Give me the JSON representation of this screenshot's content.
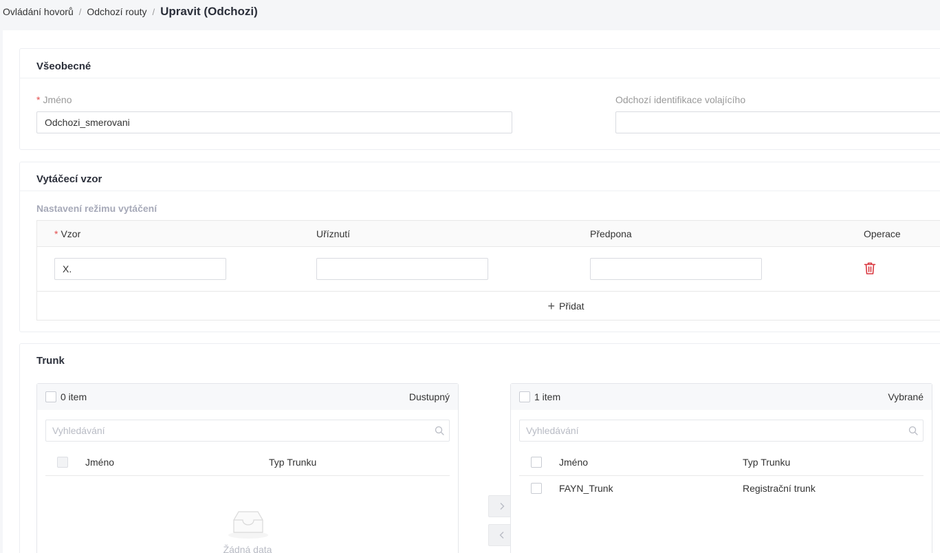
{
  "breadcrumb": {
    "items": [
      "Ovládání hovorů",
      "Odchozí routy"
    ],
    "separator": "/",
    "current": "Upravit (Odchozi)"
  },
  "general": {
    "title": "Všeobecné",
    "name_label": "Jméno",
    "name_required_mark": "*",
    "name_value": "Odchozi_smerovani",
    "caller_id_label": "Odchozí identifikace volajícího",
    "caller_id_value": ""
  },
  "dial_pattern": {
    "title": "Vytáčecí vzor",
    "subtitle": "Nastavení režimu vytáčení",
    "columns": {
      "pattern": "Vzor",
      "strip": "Uříznutí",
      "prefix": "Předpona",
      "operation": "Operace"
    },
    "required_mark": "*",
    "rows": [
      {
        "pattern": "X.",
        "strip": "",
        "prefix": ""
      }
    ],
    "add_label": "Přidat",
    "add_icon": "plus-icon",
    "delete_icon": "trash-icon"
  },
  "trunk": {
    "title": "Trunk",
    "available": {
      "count_label": "0 item",
      "title": "Dustupný",
      "search_placeholder": "Vyhledávání",
      "col_name": "Jméno",
      "col_type": "Typ Trunku",
      "empty_text": "Žádná data",
      "items": []
    },
    "selected": {
      "count_label": "1 item",
      "title": "Vybrané",
      "search_placeholder": "Vyhledávání",
      "col_name": "Jméno",
      "col_type": "Typ Trunku",
      "items": [
        {
          "name": "FAYN_Trunk",
          "type": "Registrační trunk"
        }
      ]
    },
    "move_right_icon": "chevron-right-icon",
    "move_left_icon": "chevron-left-icon"
  },
  "colors": {
    "required": "#e34d4d",
    "trash": "#d9363e",
    "muted": "#999999",
    "border": "#d9dbe0"
  }
}
